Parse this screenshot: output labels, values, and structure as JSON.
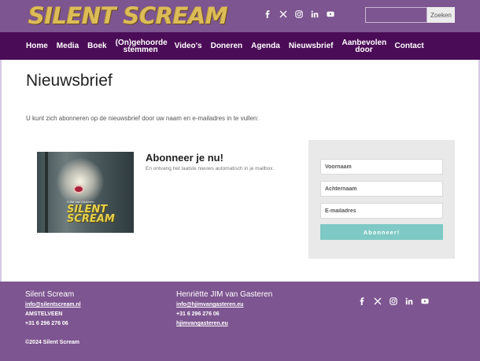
{
  "header": {
    "logo_text": "SILENT SCREAM",
    "search": {
      "placeholder": "",
      "button_label": "Zoeken"
    },
    "social_icons": [
      "facebook-icon",
      "x-icon",
      "instagram-icon",
      "linkedin-icon",
      "youtube-icon"
    ]
  },
  "nav": {
    "items": [
      {
        "label": "Home"
      },
      {
        "label": "Media"
      },
      {
        "label": "Boek"
      },
      {
        "label": "(On)gehoorde stemmen"
      },
      {
        "label": "Video's"
      },
      {
        "label": "Doneren"
      },
      {
        "label": "Agenda"
      },
      {
        "label": "Nieuwsbrief"
      },
      {
        "label": "Aanbevolen door"
      },
      {
        "label": "Contact"
      }
    ]
  },
  "main": {
    "title": "Nieuwsbrief",
    "intro": "U kunt zich abonneren op de nieuwsbrief door uw naam en e-mailadres in te vullen:",
    "cover": {
      "small_text": "HJIM van Gasteren",
      "title": "SILENT SCREAM"
    },
    "subscribe_heading": "Abonneer je nu!",
    "subscribe_text": "En ontvang het laatste nieuws automatisch in je mailbox."
  },
  "form": {
    "first_name_placeholder": "Voornaam",
    "last_name_placeholder": "Achternaam",
    "email_placeholder": "E-mailadres",
    "submit_label": "Abonneer!"
  },
  "footer": {
    "col1": {
      "heading": "Silent Scream",
      "email": "info@silentscream.nl",
      "city": "AMSTELVEEN",
      "phone": "+31 6 296 276 06",
      "copyright": "©2024 Silent Scream"
    },
    "col2": {
      "heading": "Henriëtte JIM van Gasteren",
      "email": "info@hjimvangasteren.eu",
      "phone": "+31 6 296 276 06",
      "website": "hjimvangasteren.eu"
    }
  },
  "colors": {
    "header_purple": "#7d5590",
    "nav_dark_purple": "#4b0c57",
    "logo_gold": "#dcbc57",
    "button_teal": "#7ec9c5",
    "form_bg": "#e9e9e9"
  }
}
